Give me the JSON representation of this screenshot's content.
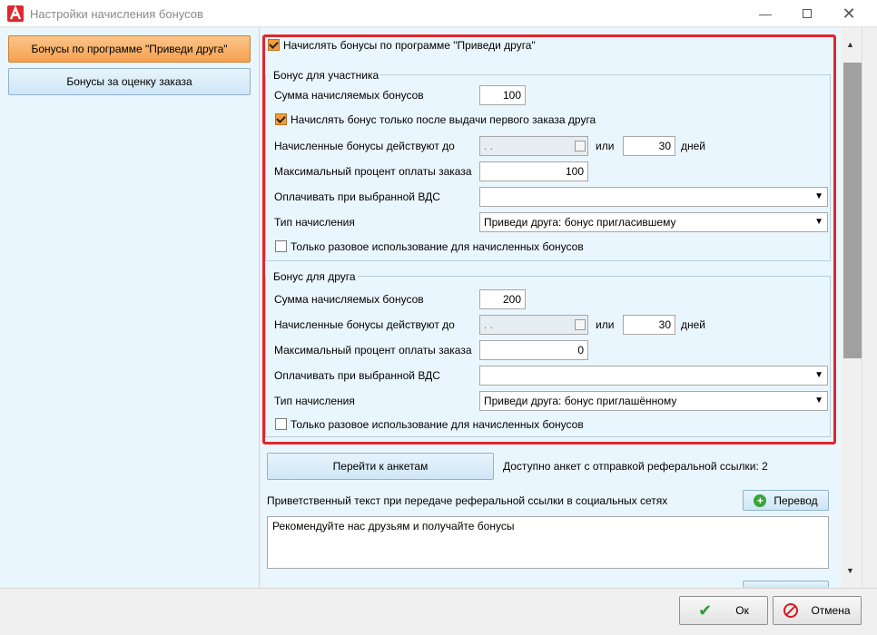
{
  "window": {
    "title": "Настройки начисления бонусов",
    "minimize_icon": "minimize-icon",
    "maximize_icon": "maximize-icon",
    "close_icon": "close-icon"
  },
  "nav": {
    "items": [
      {
        "label": "Бонусы по программе \"Приведи друга\"",
        "active": true
      },
      {
        "label": "Бонусы за оценку заказа",
        "active": false
      }
    ]
  },
  "main": {
    "enable_label": "Начислять бонусы по программе \"Приведи друга\"",
    "enable_checked": true,
    "participant": {
      "group_title": "Бонус для участника",
      "amount_label": "Сумма начисляемых бонусов",
      "amount_value": "100",
      "first_order_label": "Начислять бонус только после выдачи первого заказа друга",
      "first_order_checked": true,
      "valid_until_label": "Начисленные бонусы действуют до",
      "valid_until_date": " .  .",
      "or_label": "или",
      "days_value": "30",
      "days_label": "дней",
      "max_percent_label": "Максимальный процент оплаты заказа",
      "max_percent_value": "100",
      "pay_vds_label": "Оплачивать при выбранной ВДС",
      "pay_vds_value": "",
      "accrual_type_label": "Тип начисления",
      "accrual_type_value": "Приведи друга: бонус пригласившему",
      "one_time_label": "Только разовое использование для начисленных бонусов",
      "one_time_checked": false
    },
    "friend": {
      "group_title": "Бонус для друга",
      "amount_label": "Сумма начисляемых бонусов",
      "amount_value": "200",
      "valid_until_label": "Начисленные бонусы действуют до",
      "valid_until_date": " .  .",
      "or_label": "или",
      "days_value": "30",
      "days_label": "дней",
      "max_percent_label": "Максимальный процент оплаты заказа",
      "max_percent_value": "0",
      "pay_vds_label": "Оплачивать при выбранной ВДС",
      "pay_vds_value": "",
      "accrual_type_label": "Тип начисления",
      "accrual_type_value": "Приведи друга: бонус приглашённому",
      "one_time_label": "Только разовое использование для начисленных бонусов",
      "one_time_checked": false
    },
    "goto_surveys_label": "Перейти к анкетам",
    "surveys_available_text": "Доступно анкет с отправкой реферальной ссылки: 2",
    "welcome_text_label": "Приветственный текст при передаче реферальной ссылки в социальных сетях",
    "translate_label": "Перевод",
    "welcome_text_value": "Рекомендуйте нас друзьям и получайте бонусы"
  },
  "footer": {
    "ok_label": "Ок",
    "cancel_label": "Отмена"
  },
  "colors": {
    "accent_orange": "#f6a14f",
    "highlight_red": "#e0262e",
    "panel_bg": "#eaf6fd"
  }
}
